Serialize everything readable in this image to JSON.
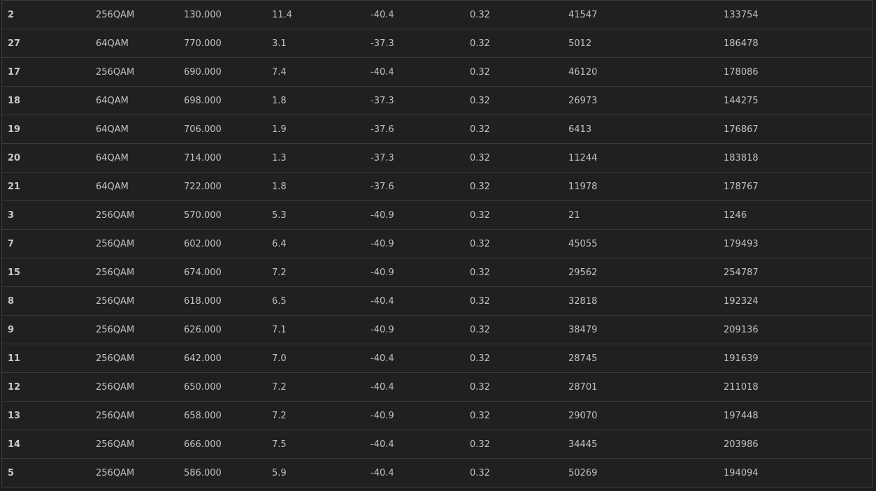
{
  "table": {
    "rows": [
      [
        "2",
        "256QAM",
        "130.000",
        "11.4",
        "-40.4",
        "0.32",
        "41547",
        "133754"
      ],
      [
        "27",
        "64QAM",
        "770.000",
        "3.1",
        "-37.3",
        "0.32",
        "5012",
        "186478"
      ],
      [
        "17",
        "256QAM",
        "690.000",
        "7.4",
        "-40.4",
        "0.32",
        "46120",
        "178086"
      ],
      [
        "18",
        "64QAM",
        "698.000",
        "1.8",
        "-37.3",
        "0.32",
        "26973",
        "144275"
      ],
      [
        "19",
        "64QAM",
        "706.000",
        "1.9",
        "-37.6",
        "0.32",
        "6413",
        "176867"
      ],
      [
        "20",
        "64QAM",
        "714.000",
        "1.3",
        "-37.3",
        "0.32",
        "11244",
        "183818"
      ],
      [
        "21",
        "64QAM",
        "722.000",
        "1.8",
        "-37.6",
        "0.32",
        "11978",
        "178767"
      ],
      [
        "3",
        "256QAM",
        "570.000",
        "5.3",
        "-40.9",
        "0.32",
        "21",
        "1246"
      ],
      [
        "7",
        "256QAM",
        "602.000",
        "6.4",
        "-40.9",
        "0.32",
        "45055",
        "179493"
      ],
      [
        "15",
        "256QAM",
        "674.000",
        "7.2",
        "-40.9",
        "0.32",
        "29562",
        "254787"
      ],
      [
        "8",
        "256QAM",
        "618.000",
        "6.5",
        "-40.4",
        "0.32",
        "32818",
        "192324"
      ],
      [
        "9",
        "256QAM",
        "626.000",
        "7.1",
        "-40.9",
        "0.32",
        "38479",
        "209136"
      ],
      [
        "11",
        "256QAM",
        "642.000",
        "7.0",
        "-40.4",
        "0.32",
        "28745",
        "191639"
      ],
      [
        "12",
        "256QAM",
        "650.000",
        "7.2",
        "-40.4",
        "0.32",
        "28701",
        "211018"
      ],
      [
        "13",
        "256QAM",
        "658.000",
        "7.2",
        "-40.9",
        "0.32",
        "29070",
        "197448"
      ],
      [
        "14",
        "256QAM",
        "666.000",
        "7.5",
        "-40.4",
        "0.32",
        "34445",
        "203986"
      ],
      [
        "5",
        "256QAM",
        "586.000",
        "5.9",
        "-40.4",
        "0.32",
        "50269",
        "194094"
      ]
    ]
  }
}
